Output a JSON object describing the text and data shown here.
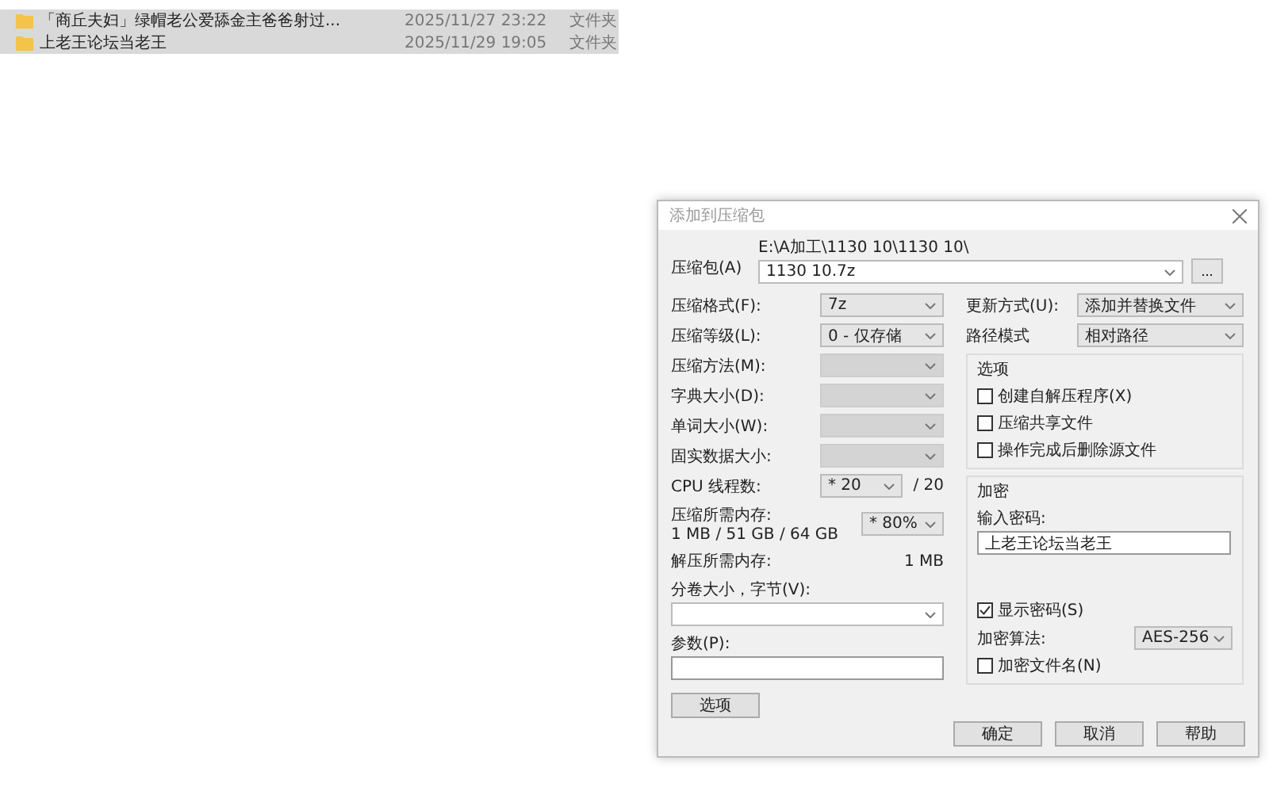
{
  "files": [
    {
      "name": "「商丘夫妇」绿帽老公爱舔金主爸爸射过...",
      "date": "2025/11/27 23:22",
      "type": "文件夹",
      "selected": true
    },
    {
      "name": "上老王论坛当老王",
      "date": "2025/11/29 19:05",
      "type": "文件夹",
      "selected": true
    }
  ],
  "dialog": {
    "title": "添加到压缩包",
    "archive": {
      "label": "压缩包(A)",
      "path": "E:\\A加工\\1130 10\\1130 10\\",
      "value": "1130 10.7z",
      "browse": "..."
    },
    "left_fields": [
      {
        "label": "压缩格式(F):",
        "value": "7z",
        "disabled": false
      },
      {
        "label": "压缩等级(L):",
        "value": "0 - 仅存储",
        "disabled": false
      },
      {
        "label": "压缩方法(M):",
        "disabled": true
      },
      {
        "label": "字典大小(D):",
        "disabled": true
      },
      {
        "label": "单词大小(W):",
        "disabled": true
      },
      {
        "label": "固实数据大小:",
        "disabled": true
      }
    ],
    "cpu": {
      "label": "CPU 线程数:",
      "value": "* 20",
      "total": "/ 20"
    },
    "memory": {
      "label": "压缩所需内存:",
      "detail": "1 MB / 51 GB / 64 GB",
      "value": "* 80%"
    },
    "decompress": {
      "label": "解压所需内存:",
      "value": "1 MB"
    },
    "volume": {
      "label": "分卷大小，字节(V):"
    },
    "params": {
      "label": "参数(P):"
    },
    "options_button": "选项",
    "right_fields": [
      {
        "label": "更新方式(U):",
        "value": "添加并替换文件"
      },
      {
        "label": "路径模式",
        "value": "相对路径"
      }
    ],
    "options": {
      "title": "选项",
      "checkboxes": [
        {
          "label": "创建自解压程序(X)",
          "checked": false
        },
        {
          "label": "压缩共享文件",
          "checked": false
        },
        {
          "label": "操作完成后删除源文件",
          "checked": false
        }
      ]
    },
    "encryption": {
      "title": "加密",
      "password_label": "输入密码:",
      "password": "上老王论坛当老王",
      "show_password": {
        "label": "显示密码(S)",
        "checked": true
      },
      "algorithm": {
        "label": "加密算法:",
        "value": "AES-256"
      },
      "encrypt_names": {
        "label": "加密文件名(N)",
        "checked": false
      }
    },
    "buttons": [
      "确定",
      "取消",
      "帮助"
    ]
  }
}
